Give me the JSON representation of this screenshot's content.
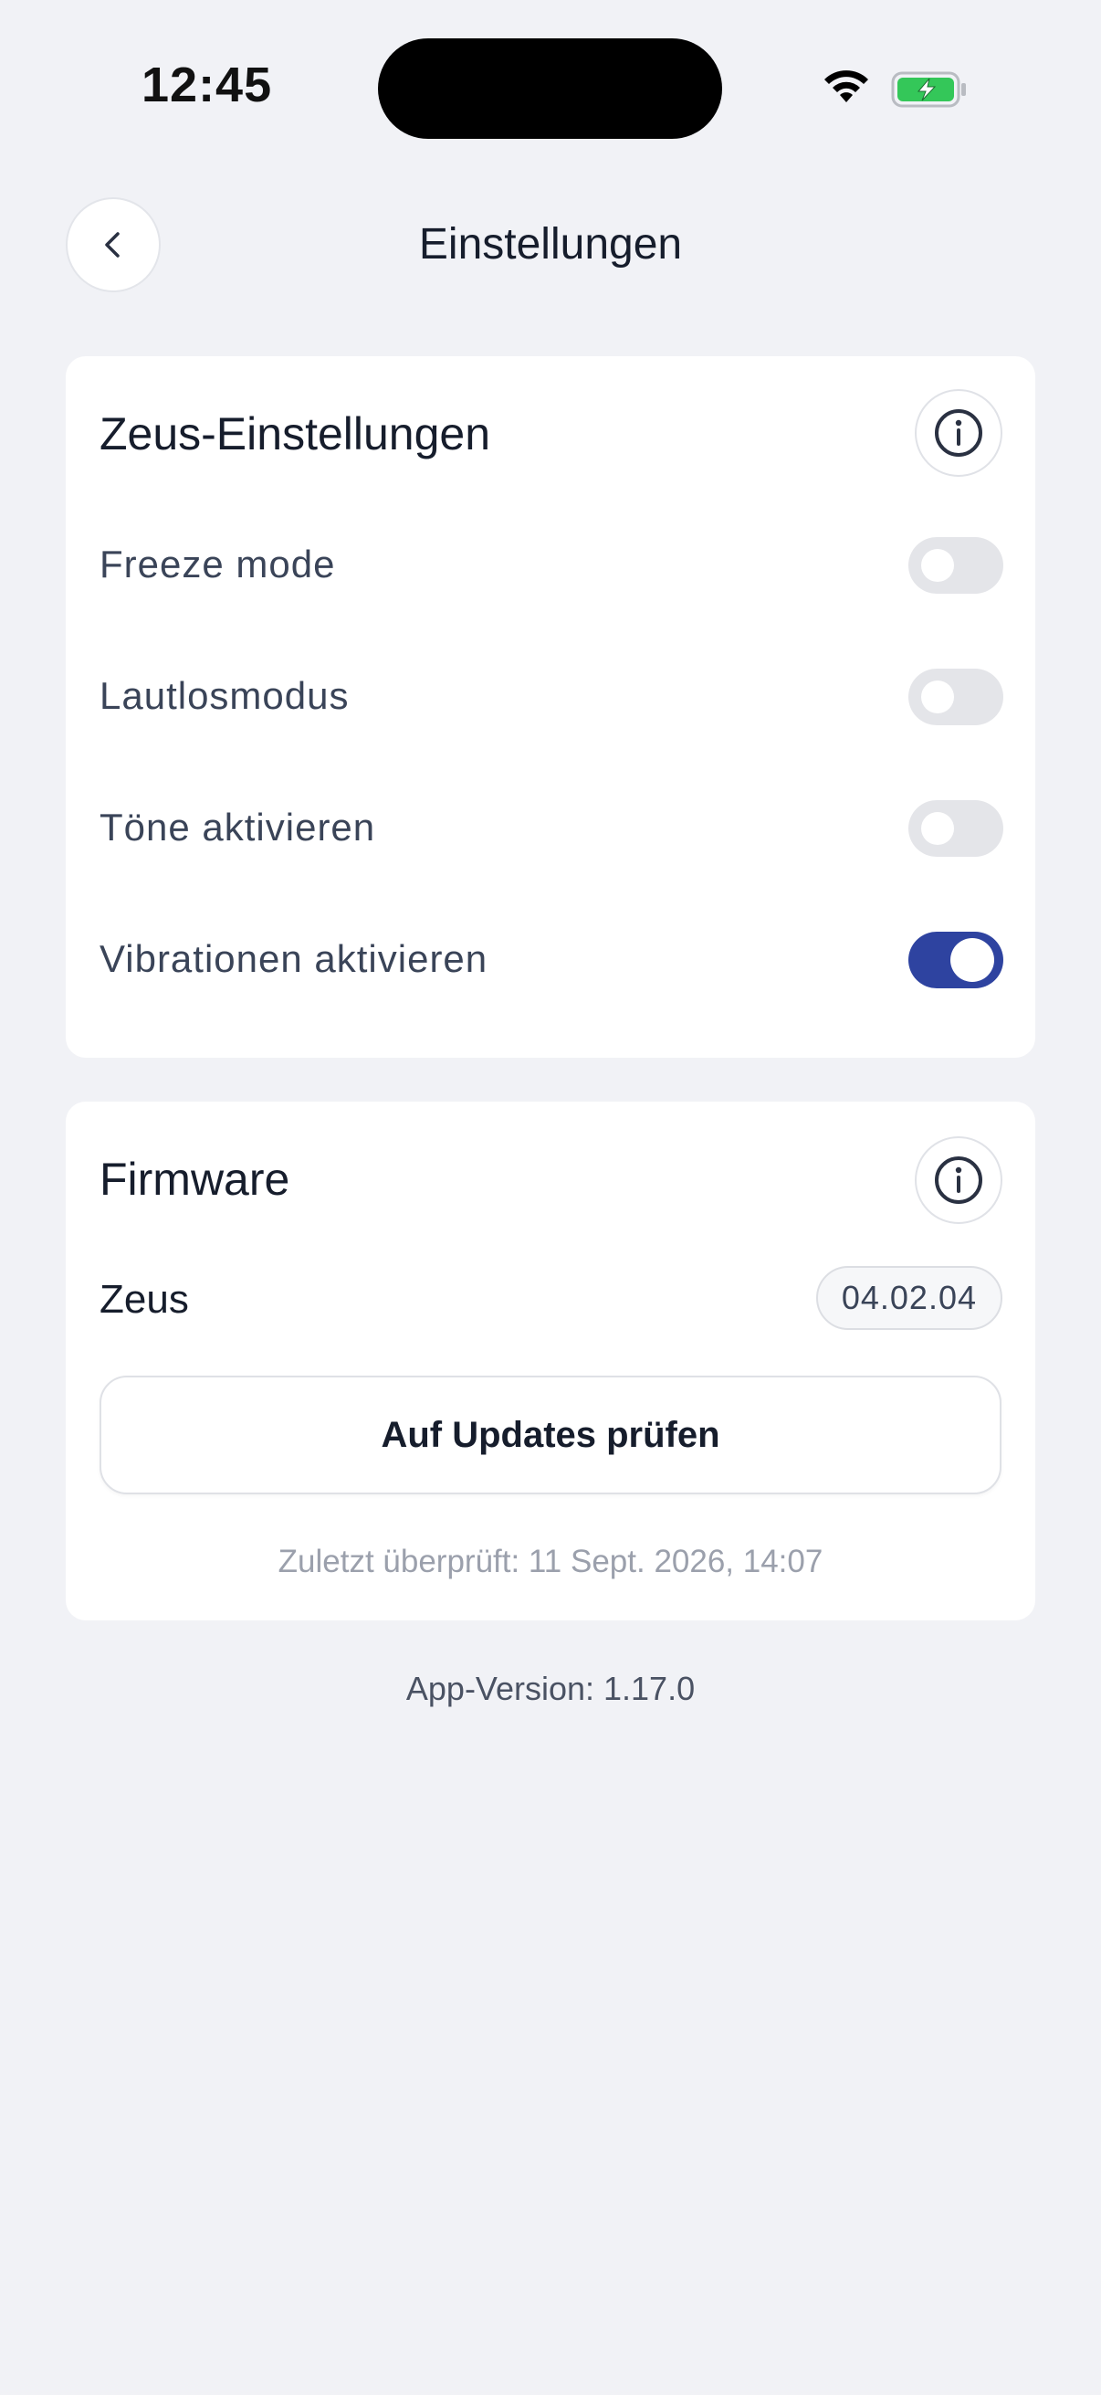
{
  "status_bar": {
    "time": "12:45",
    "wifi_icon": "wifi-icon",
    "battery_icon": "battery-charging-icon",
    "battery_color": "#34c759"
  },
  "header": {
    "title": "Einstellungen",
    "back_icon": "chevron-left-icon"
  },
  "settings_card": {
    "title": "Zeus-Einstellungen",
    "info_icon": "info-icon",
    "items": [
      {
        "label": "Freeze mode",
        "enabled": false
      },
      {
        "label": "Lautlosmodus",
        "enabled": false
      },
      {
        "label": "Töne aktivieren",
        "enabled": false
      },
      {
        "label": "Vibrationen aktivieren",
        "enabled": true
      }
    ]
  },
  "firmware_card": {
    "title": "Firmware",
    "info_icon": "info-icon",
    "device": "Zeus",
    "version": "04.02.04",
    "update_button": "Auf Updates prüfen",
    "last_checked": "Zuletzt überprüft: 11 Sept. 2026, 14:07"
  },
  "footer": {
    "app_version": "App-Version: 1.17.0"
  },
  "colors": {
    "accent": "#2e43a0",
    "background": "#f1f2f6",
    "card": "#ffffff"
  }
}
